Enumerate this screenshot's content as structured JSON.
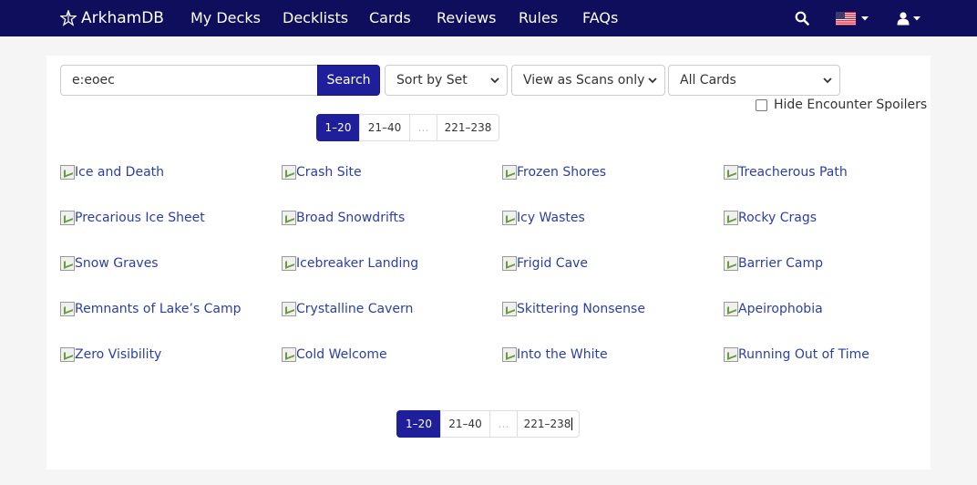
{
  "nav": {
    "brand": "ArkhamDB",
    "links": [
      "My Decks",
      "Decklists",
      "Cards",
      "Reviews",
      "Rules",
      "FAQs"
    ],
    "icons": [
      "search-icon",
      "us-flag-icon",
      "user-icon"
    ]
  },
  "search": {
    "query": "e:eoec",
    "button_label": "Search"
  },
  "filters": {
    "sort": "Sort by Set",
    "view": "View as Scans only",
    "cards": "All Cards",
    "hide_spoilers_label": "Hide Encounter Spoilers",
    "hide_spoilers_checked": false
  },
  "pagination": {
    "pages": [
      "1–20",
      "21–40",
      "…",
      "221–238"
    ],
    "active": 0
  },
  "cards": [
    "Ice and Death",
    "Crash Site",
    "Frozen Shores",
    "Treacherous Path",
    "Precarious Ice Sheet",
    "Broad Snowdrifts",
    "Icy Wastes",
    "Rocky Crags",
    "Snow Graves",
    "Icebreaker Landing",
    "Frigid Cave",
    "Barrier Camp",
    "Remnants of Lake’s Camp",
    "Crystalline Cavern",
    "Skittering Nonsense",
    "Apeirophobia",
    "Zero Visibility",
    "Cold Welcome",
    "Into the White",
    "Running Out of Time"
  ],
  "colors": {
    "navbar": "#0e0e5c",
    "primary": "#1f1f9c",
    "link": "#2a3ea8"
  }
}
